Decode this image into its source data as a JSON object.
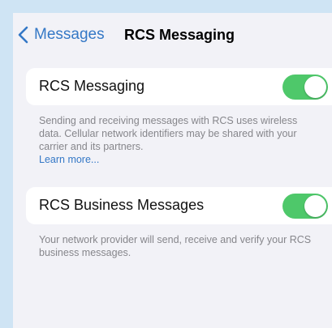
{
  "nav": {
    "back_label": "Messages",
    "title": "RCS Messaging"
  },
  "rcs_messaging": {
    "label": "RCS Messaging",
    "enabled": true,
    "footer": "Sending and receiving messages with RCS uses wireless data. Cellular network identifiers may be shared with your carrier and its partners.",
    "link": "Learn more..."
  },
  "rcs_business": {
    "label": "RCS Business Messages",
    "enabled": true,
    "footer": "Your network provider will send, receive and verify your RCS business messages."
  },
  "colors": {
    "accent": "#3478c6",
    "toggle_on": "#4ec86a",
    "background": "#f2f2f7",
    "frame": "#cfe4f4"
  },
  "icons": {
    "back": "chevron-left-icon"
  }
}
